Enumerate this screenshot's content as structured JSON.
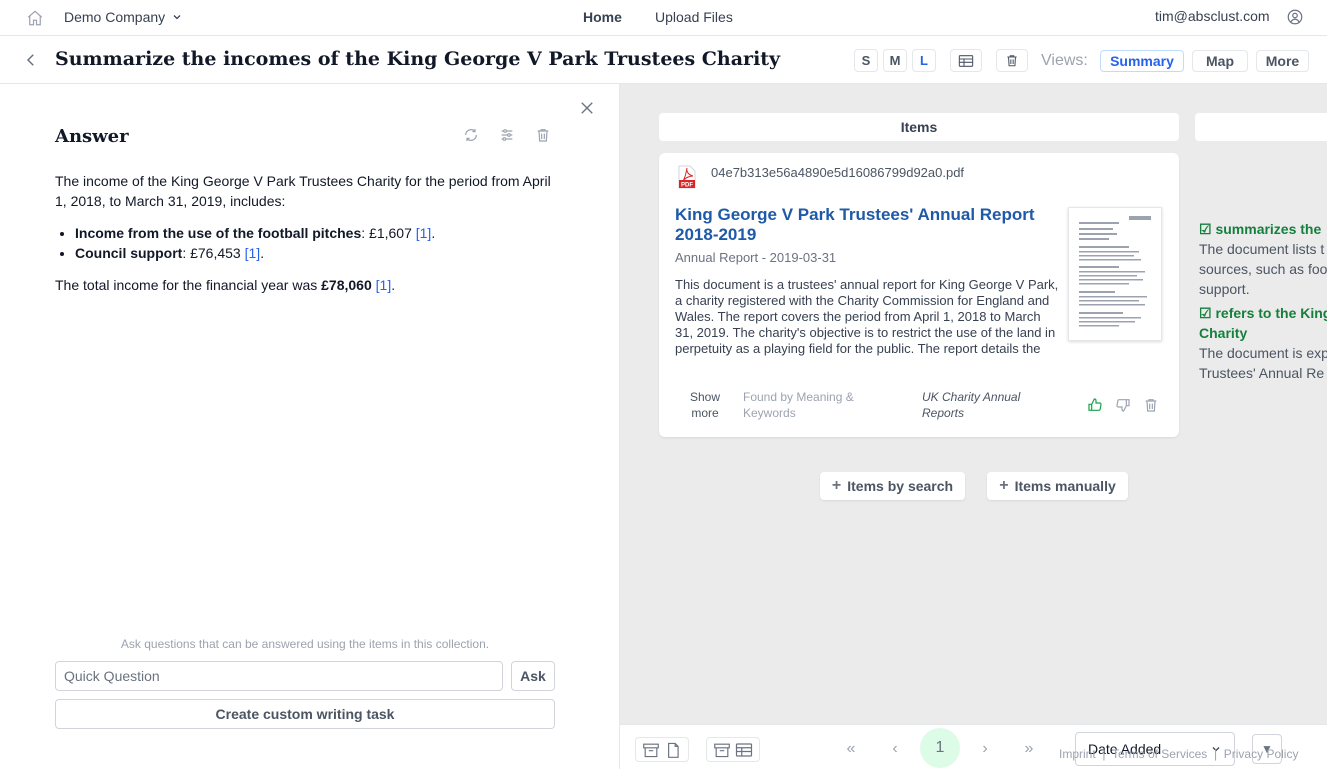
{
  "topbar": {
    "company": "Demo Company",
    "nav_home": "Home",
    "nav_upload": "Upload Files",
    "user_email": "tim@absclust.com"
  },
  "titlebar": {
    "title": "Summarize the incomes of the King George V Park Trustees Charity",
    "sizes": [
      "S",
      "M",
      "L"
    ],
    "active_size": "L",
    "views_label": "Views:",
    "views": [
      "Summary",
      "Map",
      "More"
    ],
    "active_view": "Summary"
  },
  "answer": {
    "heading": "Answer",
    "intro": "The income of the King George V Park Trustees Charity for the period from April 1, 2018, to March 31, 2019, includes:",
    "items": [
      {
        "label": "Income from the use of the football pitches",
        "value": ": £1,607 ",
        "ref": "[1]",
        "end": "."
      },
      {
        "label": "Council support",
        "value": ": £76,453 ",
        "ref": "[1]",
        "end": "."
      }
    ],
    "total_prefix": "The total income for the financial year was ",
    "total_value": "£78,060",
    "total_ref": "[1]",
    "total_end": ".",
    "hint": "Ask questions that can be answered using the items in this collection.",
    "quick_placeholder": "Quick Question",
    "ask_label": "Ask",
    "custom_label": "Create custom writing task"
  },
  "items_panel": {
    "column_header": "Items",
    "card": {
      "filename": "04e7b313e56a4890e5d16086799d92a0.pdf",
      "title": "King George V Park Trustees' Annual Report 2018-2019",
      "meta": "Annual Report - 2019-03-31",
      "summary": "This document is a trustees' annual report for King George V Park, a charity registered with the Charity Commission for England and Wales. The report covers the period from April 1, 2018 to March 31, 2019. The charity's objective is to restrict the use of the land in perpetuity as a playing field for the public. The report details the charity's income and expenditur...",
      "show_more": "Show more",
      "found_by": "Found by Meaning & Keywords",
      "collection": "UK Charity Annual Reports"
    },
    "criteria": [
      {
        "title": "summarizes the",
        "desc": [
          "The document lists t",
          "sources, such as foo",
          "support."
        ]
      },
      {
        "title": "refers to the King",
        "title2": "Charity",
        "desc": [
          "The document is exp",
          "Trustees' Annual Re"
        ]
      }
    ],
    "add_search": "Items by search",
    "add_manual": "Items manually"
  },
  "bottombar": {
    "page": "1",
    "sort": "Date Added",
    "footer_imprint": "Imprint",
    "footer_sep": "|",
    "footer_terms": "Terms of Services",
    "footer_privacy": "Privacy Policy"
  },
  "colors": {
    "accent": "#2563eb",
    "doc_title": "#1e5aa8",
    "criteria_green": "#15803d",
    "page_bg": "#dcfce7"
  }
}
